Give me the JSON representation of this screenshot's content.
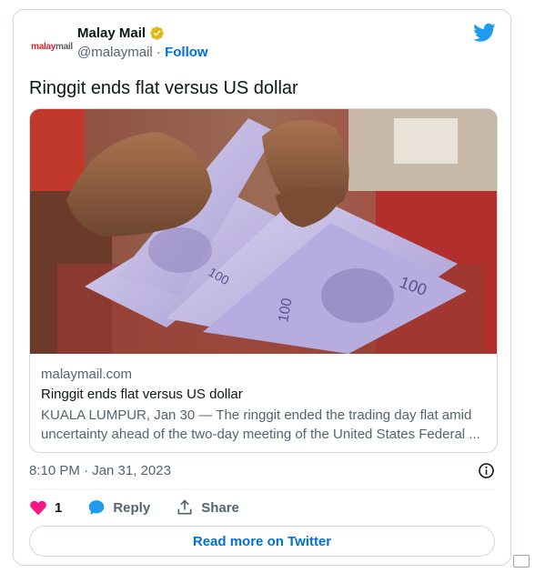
{
  "account": {
    "logo_part1": "malay",
    "logo_part2": "mail",
    "name": "Malay Mail",
    "handle": "@malaymail",
    "separator": " · ",
    "follow_label": "Follow"
  },
  "tweet": {
    "text": "Ringgit ends flat versus US dollar",
    "timestamp": "8:10 PM · Jan 31, 2023"
  },
  "link_card": {
    "domain": "malaymail.com",
    "title": "Ringgit ends flat versus US dollar",
    "description": "KUALA LUMPUR, Jan 30 — The ringgit ended the trading day flat amid uncertainty ahead of the two-day meeting of the United States Federal ..."
  },
  "actions": {
    "like_count": "1",
    "reply_label": "Reply",
    "share_label": "Share"
  },
  "read_more_label": "Read more on Twitter",
  "colors": {
    "link_blue": "#006fd6",
    "verified_gold": "#e2b719",
    "like_pink": "#f91880",
    "twitter_blue": "#1d9bf0"
  },
  "icons": [
    "verified-badge-icon",
    "twitter-bird-icon",
    "info-icon",
    "heart-icon",
    "reply-bubble-icon",
    "share-icon"
  ]
}
